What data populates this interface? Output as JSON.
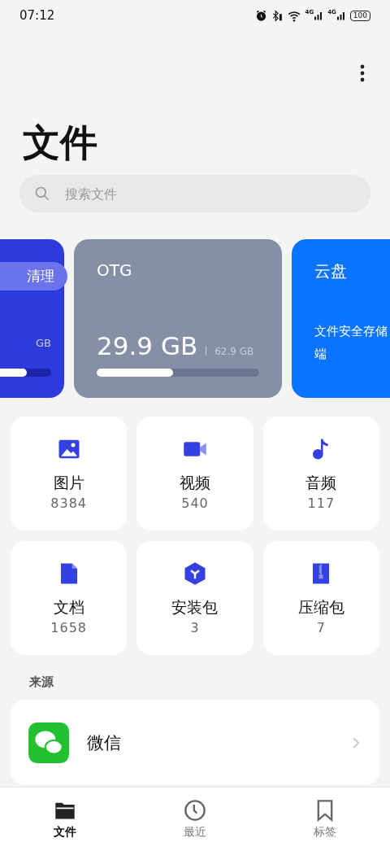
{
  "status_bar": {
    "time": "07:12",
    "networks": [
      "4G",
      "4G"
    ],
    "battery": "100"
  },
  "title": "文件",
  "search": {
    "placeholder": "搜索文件"
  },
  "storage_cards": [
    {
      "kind": "internal",
      "button": "清理",
      "capacity": "GB",
      "level": 0.86
    },
    {
      "kind": "otg",
      "name": "OTG",
      "used": "29.9 GB",
      "total": "62.9 GB",
      "level": 0.47
    },
    {
      "kind": "cloud",
      "name": "云盘",
      "description": "文件安全存储端"
    }
  ],
  "categories": [
    {
      "kind": "image",
      "label": "图片",
      "count": "8384"
    },
    {
      "kind": "video",
      "label": "视频",
      "count": "540"
    },
    {
      "kind": "audio",
      "label": "音频",
      "count": "117"
    },
    {
      "kind": "document",
      "label": "文档",
      "count": "1658"
    },
    {
      "kind": "package",
      "label": "安装包",
      "count": "3"
    },
    {
      "kind": "archive",
      "label": "压缩包",
      "count": "7"
    }
  ],
  "sources_heading": "来源",
  "sources": [
    {
      "label": "微信"
    }
  ],
  "nav": [
    {
      "kind": "files",
      "label": "文件",
      "selected": true
    },
    {
      "kind": "recent",
      "label": "最近",
      "selected": false
    },
    {
      "kind": "tags",
      "label": "标签",
      "selected": false
    }
  ]
}
